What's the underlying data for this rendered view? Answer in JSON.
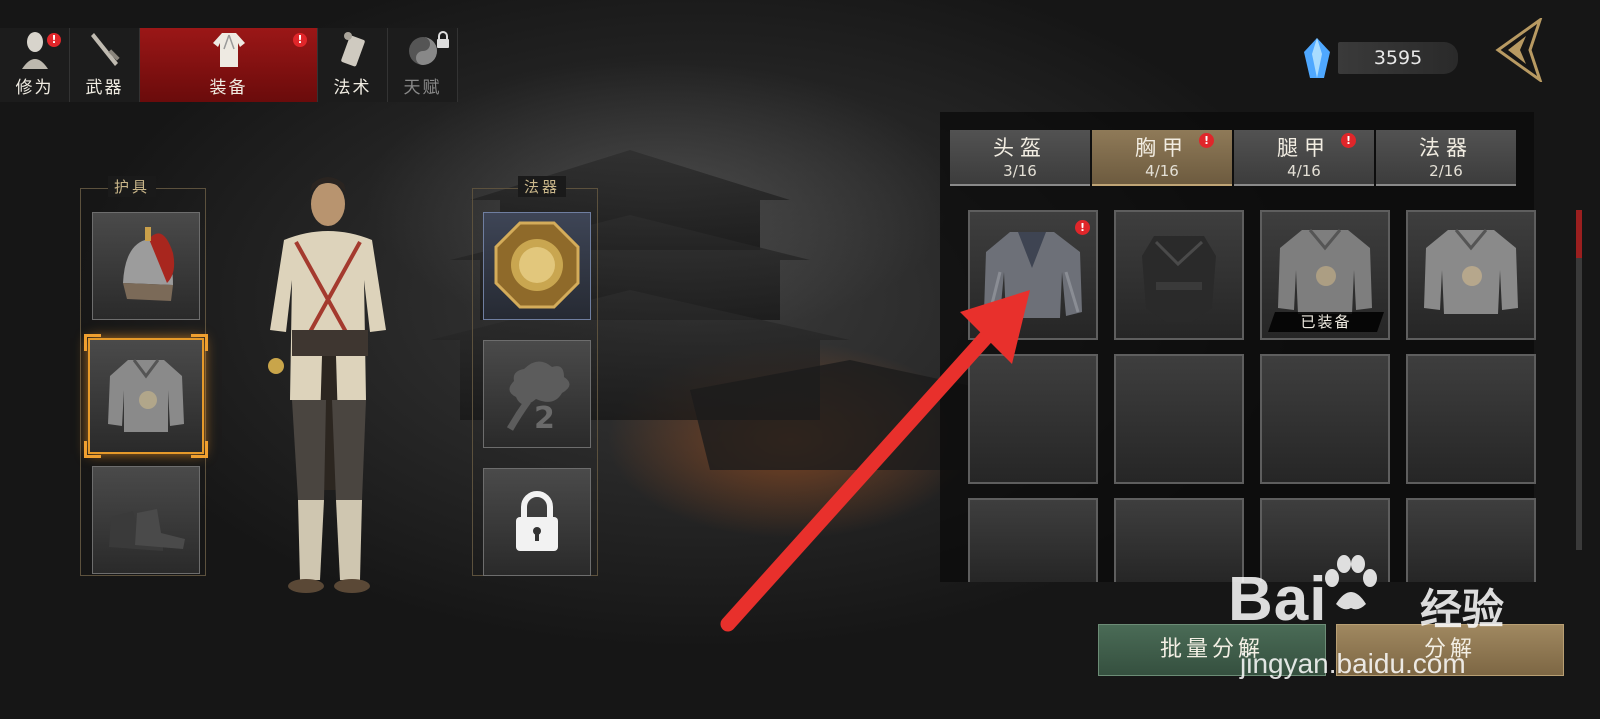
{
  "top_tabs": [
    {
      "label": "修为",
      "icon": "cultivation-icon",
      "alert": "!"
    },
    {
      "label": "武器",
      "icon": "weapon-icon"
    },
    {
      "label": "装备",
      "icon": "equipment-robe-icon",
      "alert": "!",
      "active": true
    },
    {
      "label": "法术",
      "icon": "spell-scroll-icon"
    },
    {
      "label": "天赋",
      "icon": "talent-yinyang-icon",
      "locked": true
    }
  ],
  "currency": {
    "icon": "crystal-gem-icon",
    "value": "3595"
  },
  "left_panel": {
    "armor_title": "护具",
    "artifact_title": "法器",
    "armor_slots": [
      {
        "name": "helmet",
        "icon": "helmet-icon"
      },
      {
        "name": "chest",
        "icon": "chest-armor-icon",
        "selected": true
      },
      {
        "name": "boots",
        "icon": "boots-icon"
      }
    ],
    "artifact_slots": [
      {
        "name": "bagua-mirror",
        "icon": "bagua-mirror-icon"
      },
      {
        "name": "empty-slot-2",
        "icon": "cloud-2-icon",
        "number": "2"
      },
      {
        "name": "locked-slot-3",
        "icon": "lock-icon"
      }
    ]
  },
  "categories": [
    {
      "label": "头盔",
      "count": "3/16"
    },
    {
      "label": "胸甲",
      "count": "4/16",
      "alert": "!",
      "active": true
    },
    {
      "label": "腿甲",
      "count": "4/16",
      "alert": "!"
    },
    {
      "label": "法器",
      "count": "2/16"
    }
  ],
  "inventory": [
    {
      "item": "grey-robe",
      "alert": "!"
    },
    {
      "item": "black-leather-armor"
    },
    {
      "item": "plate-armor",
      "equipped_label": "已装备"
    },
    {
      "item": "plate-armor-2"
    }
  ],
  "buttons": {
    "batch_decompose": "批量分解",
    "decompose": "分解"
  },
  "watermark": {
    "logo": "Bai",
    "cn": "经验",
    "url": "jingyan.baidu.com"
  },
  "colors": {
    "active_tab": "#9b1717",
    "alert": "#e0262a",
    "selected_border": "#e69a2a",
    "annotation_arrow": "#e8302c"
  }
}
